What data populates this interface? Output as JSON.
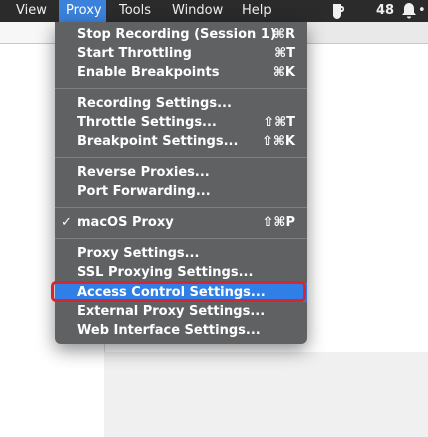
{
  "menubar": {
    "items": [
      {
        "label": "View"
      },
      {
        "label": "Proxy"
      },
      {
        "label": "Tools"
      },
      {
        "label": "Window"
      },
      {
        "label": "Help"
      }
    ],
    "active_item": "Proxy",
    "status": {
      "app_icon": "jug-icon",
      "count": "48",
      "notification_icon": "bell-icon",
      "notification_dot": "•"
    }
  },
  "proxy_menu": {
    "groups": [
      [
        {
          "label": "Stop Recording (Session 1)",
          "shortcut": "⌘R"
        },
        {
          "label": "Start Throttling",
          "shortcut": "⌘T"
        },
        {
          "label": "Enable Breakpoints",
          "shortcut": "⌘K"
        }
      ],
      [
        {
          "label": "Recording Settings...",
          "shortcut": ""
        },
        {
          "label": "Throttle Settings...",
          "shortcut": "⇧⌘T"
        },
        {
          "label": "Breakpoint Settings...",
          "shortcut": "⇧⌘K"
        }
      ],
      [
        {
          "label": "Reverse Proxies...",
          "shortcut": ""
        },
        {
          "label": "Port Forwarding...",
          "shortcut": ""
        }
      ],
      [
        {
          "label": "macOS Proxy",
          "shortcut": "⇧⌘P",
          "checked": true,
          "check_mark": "✓"
        }
      ],
      [
        {
          "label": "Proxy Settings...",
          "shortcut": ""
        },
        {
          "label": "SSL Proxying Settings...",
          "shortcut": ""
        },
        {
          "label": "Access Control Settings...",
          "shortcut": "",
          "highlighted": true
        },
        {
          "label": "External Proxy Settings...",
          "shortcut": ""
        },
        {
          "label": "Web Interface Settings...",
          "shortcut": ""
        }
      ]
    ]
  },
  "colors": {
    "menubar_bg": "#2b2b2b",
    "active_menu_bg": "#3b82dd",
    "menu_bg": "#5f6163",
    "highlight_bg": "#2f7fe6",
    "annotation_border": "#d7262f"
  }
}
